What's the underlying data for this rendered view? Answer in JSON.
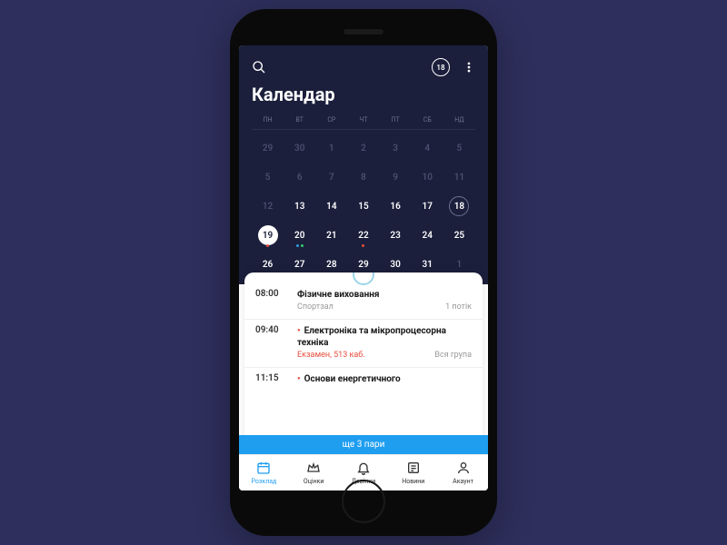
{
  "header": {
    "title": "Календар",
    "notif_count": "18",
    "weekdays": [
      "ПН",
      "ВТ",
      "СР",
      "ЧТ",
      "ПТ",
      "СБ",
      "НД"
    ]
  },
  "calendar": {
    "rows": [
      [
        {
          "n": "29",
          "dim": true
        },
        {
          "n": "30",
          "dim": true
        },
        {
          "n": "1",
          "dim": true
        },
        {
          "n": "2",
          "dim": true
        },
        {
          "n": "3",
          "dim": true
        },
        {
          "n": "4",
          "dim": true
        },
        {
          "n": "5",
          "dim": true
        }
      ],
      [
        {
          "n": "5",
          "dim": true
        },
        {
          "n": "6",
          "dim": true
        },
        {
          "n": "7",
          "dim": true
        },
        {
          "n": "8",
          "dim": true
        },
        {
          "n": "9",
          "dim": true
        },
        {
          "n": "10",
          "dim": true
        },
        {
          "n": "11",
          "dim": true
        }
      ],
      [
        {
          "n": "12",
          "dim": true
        },
        {
          "n": "13"
        },
        {
          "n": "14"
        },
        {
          "n": "15"
        },
        {
          "n": "16"
        },
        {
          "n": "17"
        },
        {
          "n": "18",
          "outlined": true
        }
      ],
      [
        {
          "n": "19",
          "selected": true,
          "dots": [
            "red"
          ]
        },
        {
          "n": "20",
          "dots": [
            "blue",
            "green"
          ]
        },
        {
          "n": "21"
        },
        {
          "n": "22",
          "dots": [
            "red"
          ]
        },
        {
          "n": "23"
        },
        {
          "n": "24"
        },
        {
          "n": "25"
        }
      ],
      [
        {
          "n": "26"
        },
        {
          "n": "27"
        },
        {
          "n": "28",
          "dots": [
            "red"
          ]
        },
        {
          "n": "29",
          "dots": [
            "red"
          ]
        },
        {
          "n": "30"
        },
        {
          "n": "31"
        },
        {
          "n": "1",
          "dim": true
        }
      ]
    ]
  },
  "events": [
    {
      "time": "08:00",
      "title": "Фізичне виховання",
      "loc": "Спортзал",
      "group": "1 потік",
      "alert": false,
      "dot": false
    },
    {
      "time": "09:40",
      "title": "Електроніка та мікропроцесорна техніка",
      "loc": "Екзамен, 513 каб.",
      "group": "Вся група",
      "alert": true,
      "dot": true
    },
    {
      "time": "11:15",
      "title": "Основи енергетичного",
      "loc": "",
      "group": "",
      "alert": false,
      "dot": true
    }
  ],
  "more_banner": "ще 3 пари",
  "tabs": [
    {
      "label": "Розклад",
      "icon": "calendar"
    },
    {
      "label": "Оцінки",
      "icon": "crown"
    },
    {
      "label": "Дзвінки",
      "icon": "bell"
    },
    {
      "label": "Новини",
      "icon": "news"
    },
    {
      "label": "Акаунт",
      "icon": "account"
    }
  ]
}
